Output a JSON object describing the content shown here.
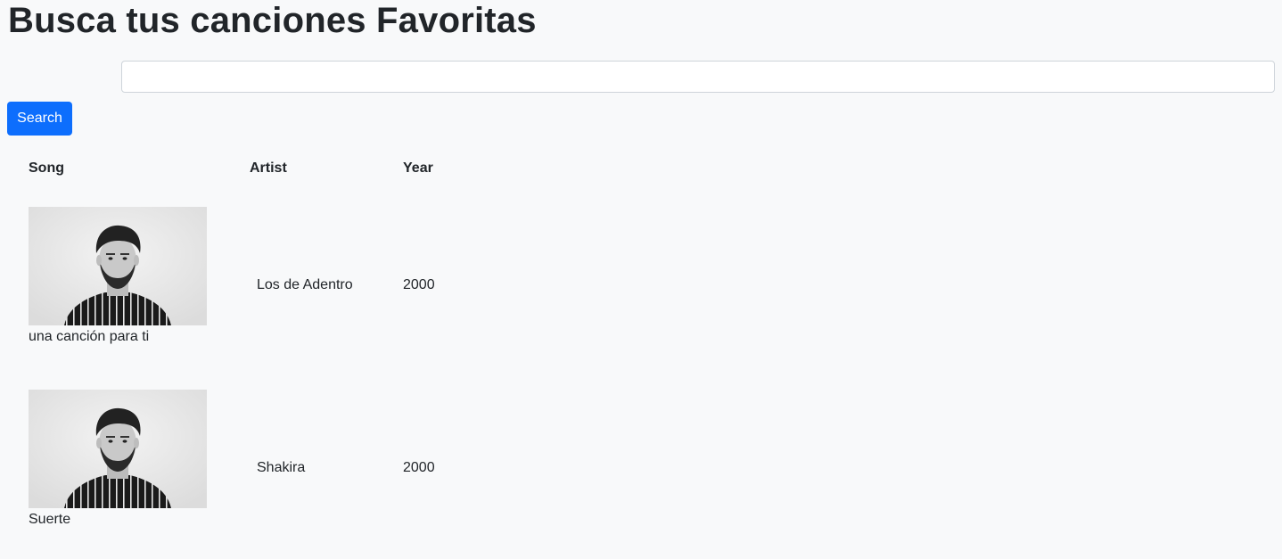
{
  "page": {
    "title": "Busca tus canciones Favoritas"
  },
  "search": {
    "value": "",
    "placeholder": "",
    "button_label": "Search"
  },
  "table": {
    "headers": {
      "song": "Song",
      "artist": "Artist",
      "year": "Year"
    },
    "rows": [
      {
        "song": "una canción para ti",
        "artist": "Los de Adentro",
        "year": "2000",
        "image": "portrait-photo"
      },
      {
        "song": "Suerte",
        "artist": "Shakira",
        "year": "2000",
        "image": "portrait-photo"
      }
    ]
  },
  "colors": {
    "background": "#f8f9fa",
    "primary": "#0d6efd",
    "text": "#212529"
  }
}
